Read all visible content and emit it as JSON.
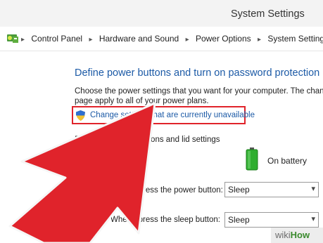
{
  "window": {
    "title": "System Settings"
  },
  "address": {
    "crumbs": [
      "Control Panel",
      "Hardware and Sound",
      "Power Options",
      "System Settings"
    ],
    "icon": "control-panel-icon"
  },
  "main": {
    "heading": "Define power buttons and turn on password protection",
    "description_line1": "Choose the power settings that you want for your computer. The changes",
    "description_line2": "page apply to all of your power plans.",
    "change_link": "Change settings that are currently unavailable",
    "section_label": "Power and sleep buttons and lid settings",
    "battery_label": "On battery",
    "power_button_label": "When I press the power button:",
    "power_button_value": "Sleep",
    "sleep_button_label": "When I press the sleep button:",
    "sleep_button_value": "Sleep"
  },
  "overlay": {
    "arrow_color": "#e0232b",
    "highlight_color": "#e0232b"
  },
  "watermark": {
    "wiki": "wiki",
    "how": "How"
  },
  "colors": {
    "link": "#1c5aa6",
    "battery": "#2fae2f"
  }
}
